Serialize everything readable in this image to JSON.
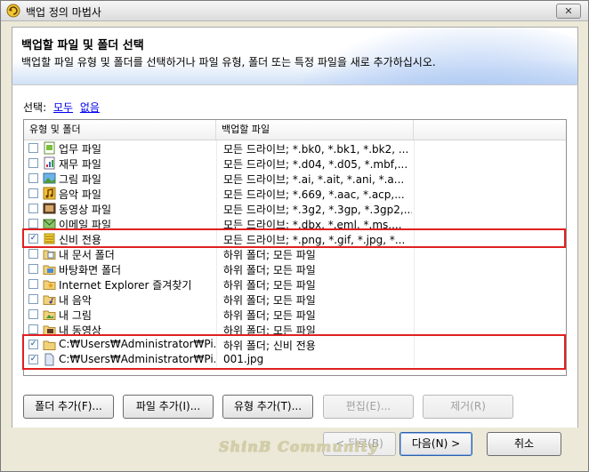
{
  "window": {
    "title": "백업 정의 마법사",
    "close_label": "✕"
  },
  "header": {
    "title": "백업할 파일 및 폴더 선택",
    "description": "백업할 파일 유형 및 폴더를 선택하거나 파일 유형, 폴더 또는 특정 파일을 새로 추가하십시오."
  },
  "select": {
    "label": "선택:",
    "all": "모두",
    "none": "없음"
  },
  "list": {
    "columns": [
      "유형 및 폴더",
      "백업할 파일",
      ""
    ],
    "rows": [
      {
        "checked": false,
        "icon": "business-file-icon",
        "name": "업무 파일",
        "files": "모든 드라이브; *.bk0, *.bk1, *.bk2, ..."
      },
      {
        "checked": false,
        "icon": "finance-file-icon",
        "name": "재무 파일",
        "files": "모든 드라이브; *.d04, *.d05, *.mbf,..."
      },
      {
        "checked": false,
        "icon": "image-file-icon",
        "name": "그림 파일",
        "files": "모든 드라이브; *.ai, *.ait, *.ani, *.a..."
      },
      {
        "checked": false,
        "icon": "music-file-icon",
        "name": "음악 파일",
        "files": "모든 드라이브; *.669, *.aac, *.acp,..."
      },
      {
        "checked": false,
        "icon": "video-file-icon",
        "name": "동영상 파일",
        "files": "모든 드라이브; *.3g2, *.3gp, *.3gp2,..."
      },
      {
        "checked": false,
        "icon": "email-file-icon",
        "name": "이메일 파일",
        "files": "모든 드라이브; *.dbx, *.eml, *.ms,..."
      },
      {
        "checked": true,
        "icon": "custom-type-icon",
        "name": "신비 전용",
        "files": "모든 드라이브; *.png, *.gif, *.jpg, *..."
      },
      {
        "checked": false,
        "icon": "documents-folder-icon",
        "name": "내 문서 폴더",
        "files": "하위 폴더; 모든 파일"
      },
      {
        "checked": false,
        "icon": "desktop-folder-icon",
        "name": "바탕화면 폴더",
        "files": "하위 폴더; 모든 파일"
      },
      {
        "checked": false,
        "icon": "favorites-folder-icon",
        "name": "Internet Explorer 즐겨찾기",
        "files": "하위 폴더; 모든 파일"
      },
      {
        "checked": false,
        "icon": "music-folder-icon",
        "name": "내 음악",
        "files": "하위 폴더; 모든 파일"
      },
      {
        "checked": false,
        "icon": "pictures-folder-icon",
        "name": "내 그림",
        "files": "하위 폴더; 모든 파일"
      },
      {
        "checked": false,
        "icon": "videos-folder-icon",
        "name": "내 동영상",
        "files": "하위 폴더; 모든 파일"
      },
      {
        "checked": true,
        "icon": "folder-icon",
        "name": "C:₩Users₩Administrator₩Pi...",
        "files": "하위 폴더; 신비 전용"
      },
      {
        "checked": true,
        "icon": "file-icon",
        "name": "C:₩Users₩Administrator₩Pi...",
        "files": "001.jpg"
      }
    ]
  },
  "buttons": {
    "add_folder": "폴더 추가(F)...",
    "add_file": "파일 추가(I)...",
    "add_type": "유형 추가(T)...",
    "edit": "편집(E)...",
    "remove": "제거(R)",
    "back": "< 뒤로(B)",
    "next": "다음(N) >",
    "cancel": "취소"
  },
  "watermark": "ShinB Community"
}
